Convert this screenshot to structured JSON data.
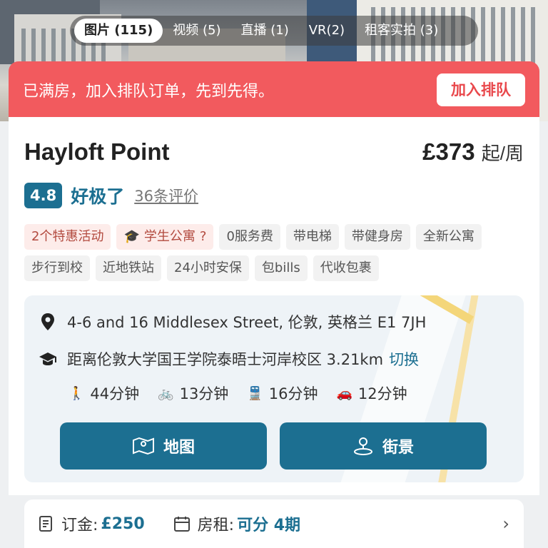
{
  "media_tabs": [
    {
      "label": "图片 (115)",
      "active": true
    },
    {
      "label": "视频 (5)",
      "active": false
    },
    {
      "label": "直播 (1)",
      "active": false
    },
    {
      "label": "VR(2)",
      "active": false
    },
    {
      "label": "租客实拍 (3)",
      "active": false
    }
  ],
  "banner": {
    "text": "已满房，加入排队订单，先到先得。",
    "button_label": "加入排队"
  },
  "property": {
    "name": "Hayloft Point",
    "price": "£373",
    "price_unit": "起/周"
  },
  "rating": {
    "score": "4.8",
    "label": "好极了",
    "reviews": "36条评价"
  },
  "tags": [
    "2个特惠活动",
    "学生公寓",
    "0服务费",
    "带电梯",
    "带健身房",
    "全新公寓",
    "步行到校",
    "近地铁站",
    "24小时安保",
    "包bills",
    "代收包裹"
  ],
  "location": {
    "address": "4-6 and 16 Middlesex Street, 伦敦, 英格兰 E1 7JH",
    "campus": "距离伦敦大学国王学院泰晤士河岸校区 3.21km",
    "switch_label": "切换",
    "walk": "44分钟",
    "bike": "13分钟",
    "transit": "16分钟",
    "car": "12分钟",
    "map_button": "地图",
    "street_button": "街景"
  },
  "payment": {
    "deposit_label": "订金:",
    "deposit_value": "£250",
    "rent_label": "房租:",
    "rent_value": "可分 4期"
  },
  "colors": {
    "accent": "#1c6f91",
    "banner": "#f25a5e"
  }
}
